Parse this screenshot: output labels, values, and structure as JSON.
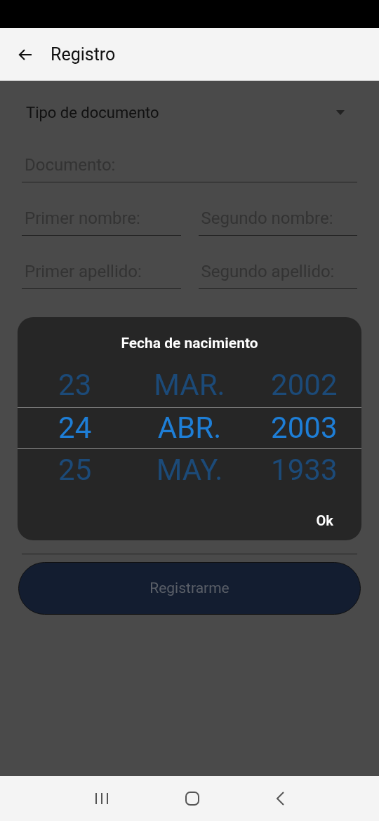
{
  "app_bar": {
    "title": "Registro"
  },
  "form": {
    "document_type": {
      "label": "Tipo de documento"
    },
    "field_rows": [
      [
        {
          "placeholder": "Documento:"
        }
      ],
      [
        {
          "placeholder": "Primer nombre:"
        },
        {
          "placeholder": "Segundo nombre:"
        }
      ],
      [
        {
          "placeholder": "Primer apellido:"
        },
        {
          "placeholder": "Segundo apellido:"
        }
      ]
    ],
    "submit": {
      "label": "Registrarme"
    }
  },
  "dialog": {
    "title": "Fecha de nacimiento",
    "columns": [
      {
        "items": [
          {
            "label": "23",
            "selected": false
          },
          {
            "label": "24",
            "selected": true
          },
          {
            "label": "25",
            "selected": false
          }
        ]
      },
      {
        "items": [
          {
            "label": "MAR.",
            "selected": false
          },
          {
            "label": "ABR.",
            "selected": true
          },
          {
            "label": "MAY.",
            "selected": false
          }
        ]
      },
      {
        "items": [
          {
            "label": "2002",
            "selected": false
          },
          {
            "label": "2003",
            "selected": true
          },
          {
            "label": "1933",
            "selected": false
          }
        ]
      }
    ],
    "ok": "Ok"
  }
}
